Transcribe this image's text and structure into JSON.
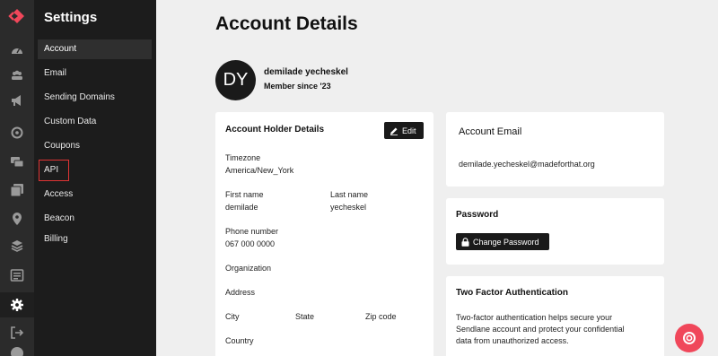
{
  "colors": {
    "rail": "#2b2b2b",
    "sidebar": "#1c1c1c",
    "accent": "#f0475a",
    "highlight": "#e03434"
  },
  "rail": {
    "icons": [
      "logo-icon",
      "dashboard-icon",
      "audience-icon",
      "campaigns-icon",
      "automations-icon",
      "messages-icon",
      "templates-icon",
      "location-icon",
      "integrations-icon",
      "reports-icon",
      "settings-icon",
      "logout-icon",
      "account-icon"
    ]
  },
  "sidebar": {
    "title": "Settings",
    "items": [
      {
        "label": "Account"
      },
      {
        "label": "Email"
      },
      {
        "label": "Sending Domains"
      },
      {
        "label": "Custom Data"
      },
      {
        "label": "Coupons"
      },
      {
        "label": "API"
      },
      {
        "label": "Access"
      },
      {
        "label": "Beacon"
      },
      {
        "label": "Billing"
      }
    ]
  },
  "main": {
    "title": "Account Details",
    "profile": {
      "initials": "DY",
      "name": "demilade yecheskel",
      "member_since": "Member since '23"
    },
    "holder": {
      "heading": "Account Holder Details",
      "edit_label": "Edit",
      "timezone_label": "Timezone",
      "timezone_value": "America/New_York",
      "first_name_label": "First name",
      "first_name_value": "demilade",
      "last_name_label": "Last name",
      "last_name_value": "yecheskel",
      "phone_label": "Phone number",
      "phone_value": "067 000 0000",
      "organization_label": "Organization",
      "address_label": "Address",
      "city_label": "City",
      "state_label": "State",
      "zip_label": "Zip code",
      "country_label": "Country"
    },
    "email": {
      "heading": "Account Email",
      "value": "demilade.yecheskel@madeforthat.org"
    },
    "password": {
      "heading": "Password",
      "button_label": "Change Password"
    },
    "two_factor": {
      "heading": "Two Factor Authentication",
      "description_1": "Two-factor authentication helps secure your",
      "description_2": "Sendlane account and protect your confidential",
      "description_3": "data from unauthorized access."
    }
  }
}
